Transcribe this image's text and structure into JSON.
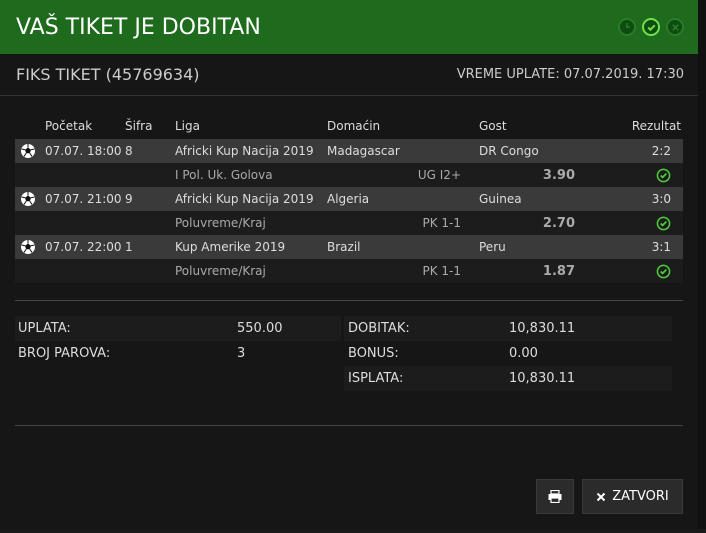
{
  "header": {
    "title": "VAŠ TIKET JE DOBITAN"
  },
  "ticket": {
    "label": "FIKS TIKET (45769634)",
    "paid_at": "VREME UPLATE: 07.07.2019. 17:30"
  },
  "columns": {
    "start": "Početak",
    "code": "Šifra",
    "league": "Liga",
    "home": "Domaćin",
    "away": "Gost",
    "result": "Rezultat"
  },
  "matches": [
    {
      "start": "07.07. 18:00",
      "code": "8",
      "league": "Africki Kup Nacija 2019",
      "home": "Madagascar",
      "away": "DR Congo",
      "result": "2:2",
      "bet_type": "I Pol. Uk. Golova",
      "pick": "UG I2+",
      "odds": "3.90"
    },
    {
      "start": "07.07. 21:00",
      "code": "9",
      "league": "Africki Kup Nacija 2019",
      "home": "Algeria",
      "away": "Guinea",
      "result": "3:0",
      "bet_type": "Poluvreme/Kraj",
      "pick": "PK 1-1",
      "odds": "2.70"
    },
    {
      "start": "07.07. 22:00",
      "code": "1",
      "league": "Kup Amerike 2019",
      "home": "Brazil",
      "away": "Peru",
      "result": "3:1",
      "bet_type": "Poluvreme/Kraj",
      "pick": "PK 1-1",
      "odds": "1.87"
    }
  ],
  "summary": {
    "stake_label": "UPLATA:",
    "stake": "550.00",
    "pairs_label": "BROJ PAROVA:",
    "pairs": "3",
    "win_label": "DOBITAK:",
    "win": "10,830.11",
    "bonus_label": "BONUS:",
    "bonus": "0.00",
    "payout_label": "ISPLATA:",
    "payout": "10,830.11"
  },
  "buttons": {
    "close_label": "ZATVORI"
  },
  "colors": {
    "header_green": "#1e6b1e",
    "odds_green": "#4ccf3a"
  }
}
